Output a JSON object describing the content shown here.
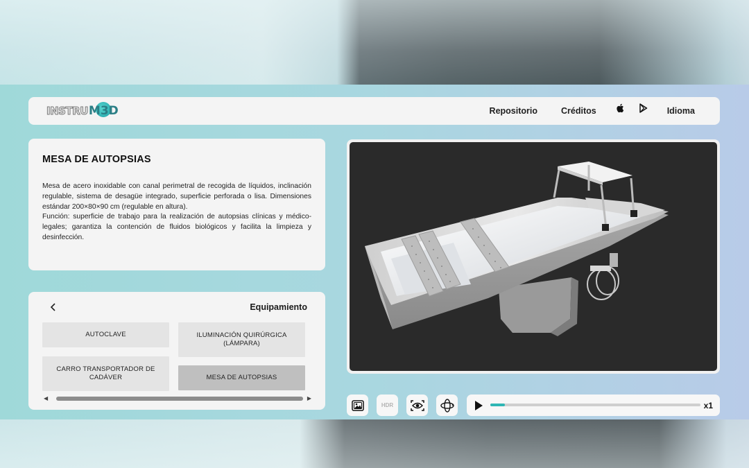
{
  "brand": {
    "logo_prefix": "INSTRU",
    "logo_suffix": "M3D",
    "accent": "#2fb6b4"
  },
  "nav": {
    "repositorio": "Repositorio",
    "creditos": "Créditos",
    "apple_icon": "apple-icon",
    "play_store_icon": "google-play-icon",
    "idioma": "Idioma"
  },
  "description": {
    "title": "MESA DE AUTOPSIAS",
    "text": "Mesa de acero inoxidable con canal perimetral de recogida de líquidos, inclinación regulable, sistema de desagüe integrado, superficie perforada o lisa. Dimensiones estándar 200×80×90 cm (regulable en altura).",
    "function": "Función: superficie de trabajo para la realización de autopsias clínicas y médico-legales; garantiza la contención de fluidos biológicos y facilita la limpieza y desinfección."
  },
  "equipment": {
    "back_icon": "chevron-left-icon",
    "heading": "Equipamiento",
    "items": [
      {
        "label": "AUTOCLAVE",
        "selected": false
      },
      {
        "label": "ILUMINACIÓN QUIRÚRGICA (LÁMPARA)",
        "selected": false
      },
      {
        "label": "CARRO TRANSPORTADOR DE CADÁVER",
        "selected": false
      },
      {
        "label": "MESA DE AUTOPSIAS",
        "selected": true
      }
    ],
    "scroll_left": "◀",
    "scroll_right": "▶"
  },
  "toolbar": {
    "background_icon": "image-icon",
    "hdr_label": "HDR",
    "view_icon": "eye-icon",
    "orbit_icon": "orbit-icon",
    "play_icon": "play-icon",
    "progress": 0.07,
    "speed": "x1"
  }
}
